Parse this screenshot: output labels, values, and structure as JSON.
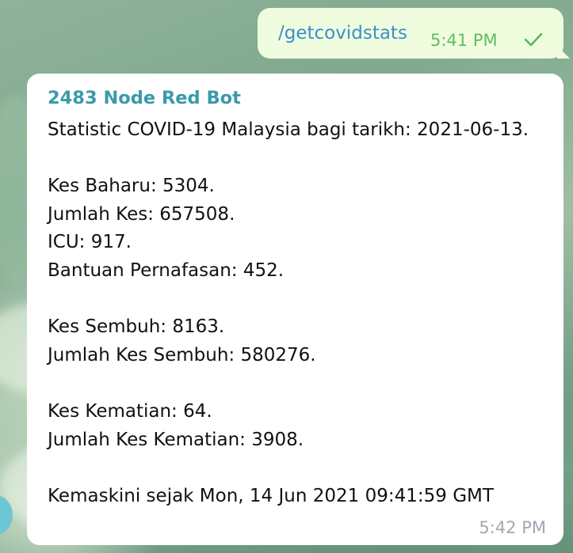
{
  "outgoing": {
    "command": "/getcovidstats",
    "time": "5:41 PM",
    "status_icon": "check-icon"
  },
  "incoming": {
    "sender": "2483 Node Red Bot",
    "lines": [
      "Statistic COVID-19 Malaysia bagi tarikh: 2021-06-13.",
      "",
      "Kes Baharu: 5304.",
      "Jumlah Kes: 657508.",
      "ICU: 917.",
      "Bantuan Pernafasan: 452.",
      "",
      "Kes Sembuh: 8163.",
      "Jumlah Kes Sembuh: 580276.",
      "",
      "Kes Kematian: 64.",
      "Jumlah Kes Kematian: 3908.",
      "",
      "Kemaskini sejak Mon, 14 Jun 2021 09:41:59 GMT"
    ],
    "time": "5:42 PM"
  },
  "colors": {
    "outgoing_bubble": "#effdde",
    "incoming_bubble": "#ffffff",
    "link": "#3a8fcf",
    "sender_name": "#3a9aaa",
    "outgoing_time": "#5cb85c",
    "incoming_time": "#a0a8b0",
    "avatar": "#6cc6d4"
  }
}
